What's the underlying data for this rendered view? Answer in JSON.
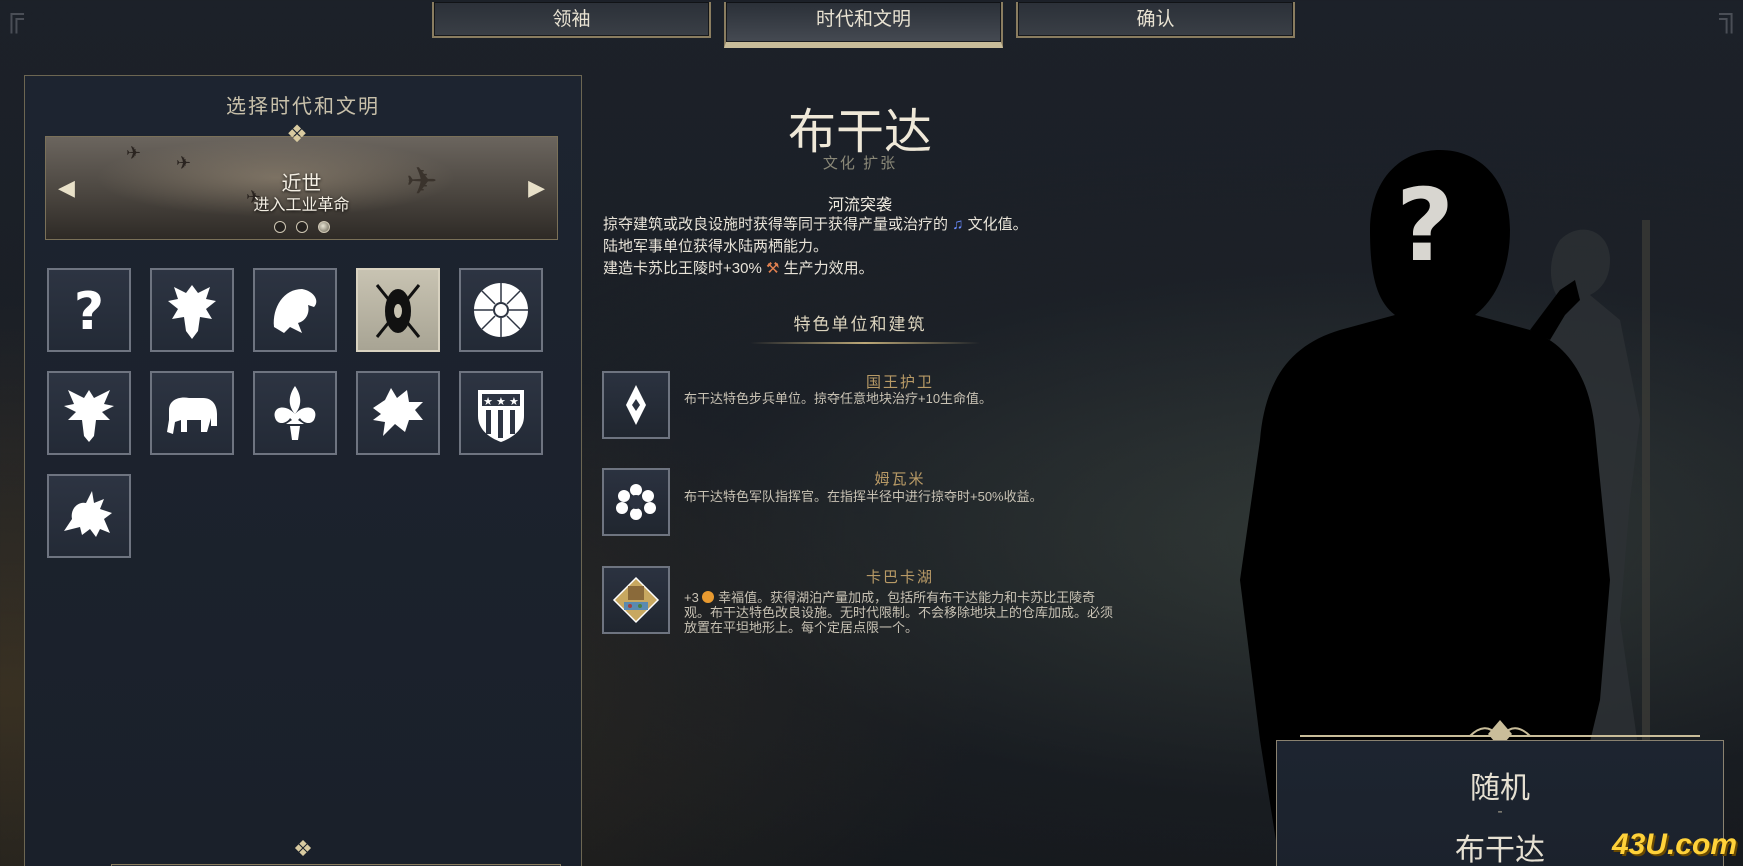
{
  "tabs": [
    {
      "label": "领袖"
    },
    {
      "label": "时代和文明"
    },
    {
      "label": "确认"
    }
  ],
  "left_panel": {
    "title": "选择时代和文明",
    "era": {
      "name": "近世",
      "subtitle": "进入工业革命"
    },
    "civilizations": [
      {
        "icon": "question-mark-icon"
      },
      {
        "icon": "double-headed-eagle-icon"
      },
      {
        "icon": "griffin-head-icon"
      },
      {
        "icon": "shield-spears-icon"
      },
      {
        "icon": "chrysanthemum-icon"
      },
      {
        "icon": "eagle-spread-icon"
      },
      {
        "icon": "elephant-icon"
      },
      {
        "icon": "fleur-de-lis-icon"
      },
      {
        "icon": "dragon-head-icon"
      },
      {
        "icon": "stars-stripes-shield-icon"
      },
      {
        "icon": "lion-griffin-icon"
      }
    ]
  },
  "civ": {
    "name": "布干达",
    "tags": "文化 扩张",
    "ability": {
      "name": "河流突袭",
      "line1": "掠夺建筑或改良设施时获得等同于获得产量或治疗的",
      "line1_end": "文化值。",
      "line2": "陆地军事单位获得水陆两栖能力。",
      "line3": "建造卡苏比王陵时+30%",
      "line3_end": "生产力效用。"
    },
    "section_title": "特色单位和建筑",
    "uniques": [
      {
        "name": "国王护卫",
        "desc": "布干达特色步兵单位。掠夺任意地块治疗+10生命值。"
      },
      {
        "name": "姆瓦米",
        "desc": "布干达特色军队指挥官。在指挥半径中进行掠夺时+50%收益。"
      },
      {
        "name": "卡巴卡湖",
        "desc_prefix": "+3",
        "desc": "幸福值。获得湖泊产量加成，包括所有布干达能力和卡苏比王陵奇观。布干达特色改良设施。无时代限制。不会移除地块上的仓库加成。必须放置在平坦地形上。每个定居点限一个。"
      }
    ]
  },
  "leader_panel": {
    "leader": "随机",
    "dash": "-",
    "civ": "布干达"
  },
  "watermark": "43U.com",
  "colors": {
    "accent_gold": "#c9bd9a",
    "culture_blue": "#6a8cff"
  }
}
